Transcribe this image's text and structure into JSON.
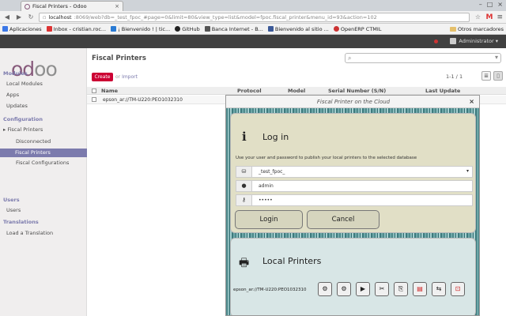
{
  "browser": {
    "tab_title": "Fiscal Printers - Odoo",
    "tab_close": "×",
    "url_host": "localhost",
    "url_rest": ":8069/web?db=_test_fpoc_#page=0&limit=80&view_type=list&model=fpoc.fiscal_printer&menu_id=93&action=102",
    "bookmarks": [
      {
        "label": "Aplicaciones",
        "color": "#3b78e7"
      },
      {
        "label": "Inbox - cristian.roc...",
        "color": "#d33"
      },
      {
        "label": "¡ Bienvenido ! | tic...",
        "color": "#2a7bd4"
      },
      {
        "label": "GitHub",
        "color": "#222"
      },
      {
        "label": "Banca Internet - B...",
        "color": "#555"
      },
      {
        "label": "Bienvenido al sitio ...",
        "color": "#3b5998"
      },
      {
        "label": "OpenERP CTMIL",
        "color": "#c33"
      }
    ],
    "other_bookmarks": "Otros marcadores"
  },
  "topbar": {
    "user": "Administrator ▾"
  },
  "sidebar": {
    "logo_main": "od",
    "logo_rest": "oo",
    "sections": [
      {
        "label": "Modules",
        "items": [
          "Local Modules",
          "Apps",
          "Updates"
        ]
      },
      {
        "label": "Configuration"
      },
      {
        "label": "Users",
        "items": [
          "Users"
        ]
      },
      {
        "label": "Translations",
        "items": [
          "Load a Translation"
        ]
      }
    ],
    "fiscal_printers": "▸ Fiscal Printers",
    "fiscal_children": [
      "Disconnected",
      "Fiscal Printers",
      "Fiscal Configurations"
    ]
  },
  "main": {
    "title": "Fiscal Printers",
    "create_label": "Create",
    "or_label": "or",
    "import_label": "Import",
    "pager": "1-1 / 1",
    "columns": [
      "Name",
      "Protocol",
      "Model",
      "Serial Number (S/N)",
      "Last Update"
    ],
    "rows": [
      {
        "name": "epson_ar://TM-U220:PEO1032310"
      }
    ]
  },
  "modal": {
    "title": "Fiscal Printer on the Cloud",
    "close": "×",
    "login": {
      "icon": "i",
      "title": "Log in",
      "description": "Use your user and password to publish your local printers to the selected database",
      "database": "_test_fpoc_",
      "username": "admin",
      "password": "•••••",
      "login_button": "Login",
      "cancel_button": "Cancel"
    },
    "printers": {
      "title": "Local Printers",
      "printer_name": "epson_ar://TM-U220:PEO1032310"
    }
  }
}
